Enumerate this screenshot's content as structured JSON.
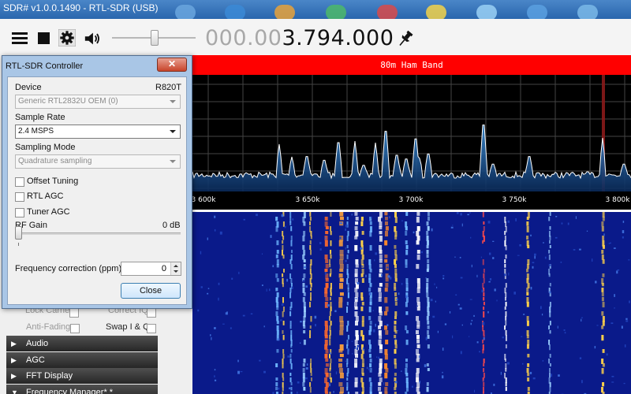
{
  "window": {
    "title": "SDR# v1.0.0.1490 - RTL-SDR (USB)"
  },
  "toolbar": {
    "frequency_dim": "000.00",
    "frequency_bright": "3.794.000",
    "volume_level": 0.5
  },
  "spectrum": {
    "band_label": "80m Ham Band",
    "ticks": [
      "3 600k",
      "3 650k",
      "3 700k",
      "3 750k",
      "3 800k"
    ]
  },
  "dialog": {
    "title": "RTL-SDR Controller",
    "close_glyph": "✕",
    "device_label": "Device",
    "tuner_name": "R820T",
    "device_value": "Generic RTL2832U OEM (0)",
    "sample_rate_label": "Sample Rate",
    "sample_rate_value": "2.4 MSPS",
    "sampling_mode_label": "Sampling Mode",
    "sampling_mode_value": "Quadrature sampling",
    "offset_tuning_label": "Offset Tuning",
    "rtl_agc_label": "RTL AGC",
    "tuner_agc_label": "Tuner AGC",
    "rf_gain_label": "RF Gain",
    "rf_gain_value": "0 dB",
    "freq_correction_label": "Frequency correction (ppm)",
    "freq_correction_value": "0",
    "close_button_label": "Close"
  },
  "panel": {
    "lock_carrier_label": "Lock Carrier",
    "correct_iq_label": "Correct IQ",
    "anti_fading_label": "Anti-Fading",
    "swap_iq_label": "Swap I & Q",
    "sections": [
      "Audio",
      "AGC",
      "FFT Display",
      "Frequency Manager* *"
    ]
  },
  "colors": {
    "band_bar": "#ff0000",
    "waterfall_base": "#0a1a8a",
    "spectrum_fill": "#2a72b8"
  }
}
